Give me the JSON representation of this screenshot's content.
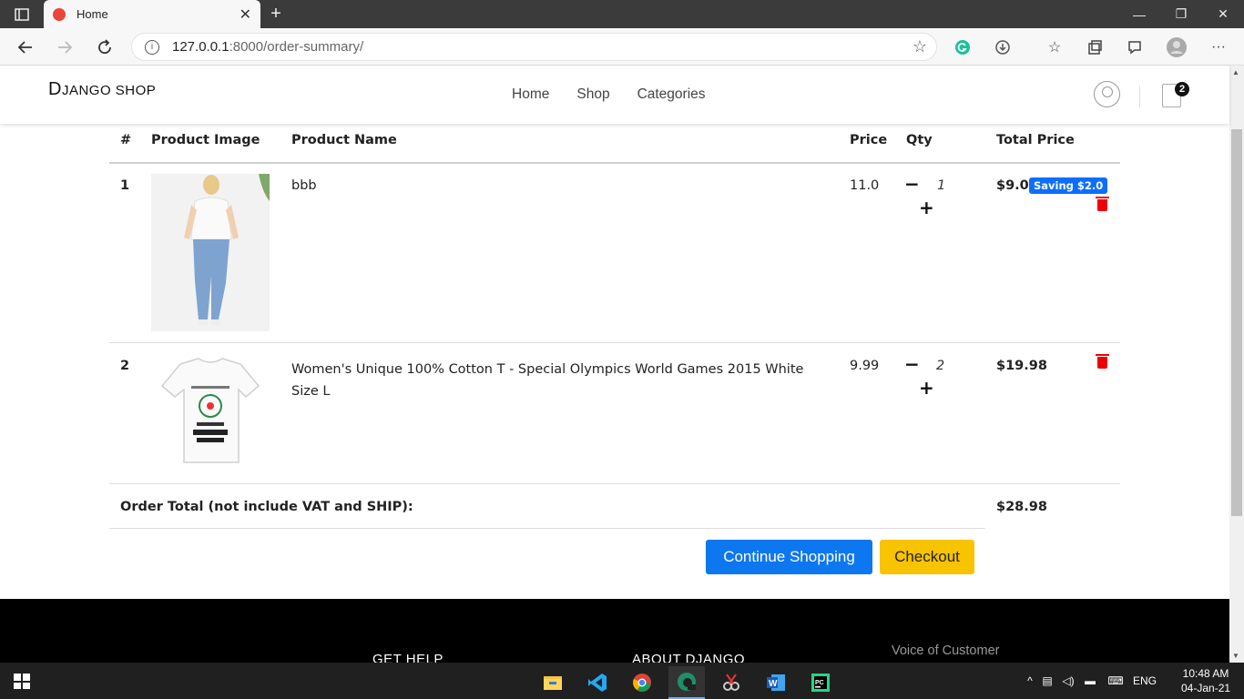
{
  "browser": {
    "tab_title": "Home",
    "tab_close": "✕",
    "new_tab": "+",
    "url_host": "127.0.0.1",
    "url_rest": ":8000/order-summary/",
    "window_controls": [
      "—",
      "❐",
      "✕"
    ]
  },
  "site": {
    "logo_first": "D",
    "logo_rest": "JANGO SHOP",
    "menu": [
      "Home",
      "Shop",
      "Categories"
    ],
    "cart_count": "2"
  },
  "table": {
    "headers": [
      "#",
      "Product Image",
      "Product Name",
      "Price",
      "Qty",
      "Total Price"
    ],
    "rows": [
      {
        "index": "1",
        "name": "bbb",
        "price": "11.0",
        "qty": "1",
        "total": "$9.0",
        "badge": "Saving $2.0"
      },
      {
        "index": "2",
        "name": "Women's Unique 100% Cotton T - Special Olympics World Games 2015 White Size L",
        "price": "9.99",
        "qty": "2",
        "total": "$19.98",
        "badge": ""
      }
    ],
    "order_total_label": "Order Total (not include VAT and SHIP):",
    "order_total_value": "$28.98"
  },
  "buttons": {
    "continue": "Continue Shopping",
    "checkout": "Checkout",
    "minus": "−",
    "plus": "+"
  },
  "footer": {
    "col1": "GET HELP",
    "col2": "ABOUT DJANGO",
    "col3": "Voice of Customer"
  },
  "taskbar": {
    "lang": "ENG",
    "time": "10:48 AM",
    "date": "04-Jan-21"
  },
  "colors": {
    "primary": "#0d77f0",
    "warning": "#f8c300",
    "badge": "#0d6efd",
    "danger": "#e00000"
  }
}
